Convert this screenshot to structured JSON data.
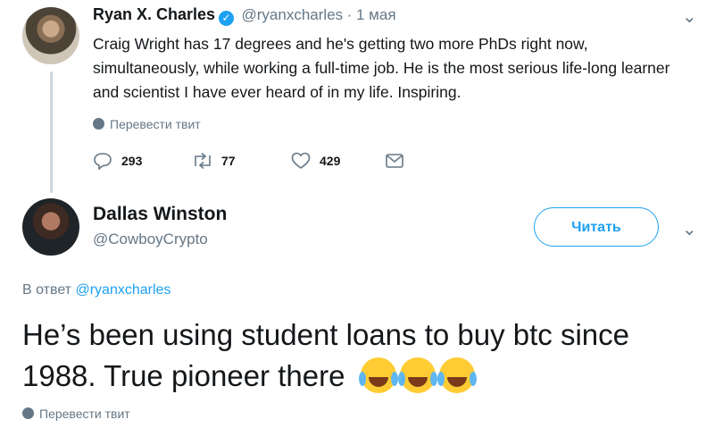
{
  "tweet1": {
    "name": "Ryan X. Charles",
    "handle": "@ryanxcharles",
    "date": "· 1 мая",
    "text": "Craig Wright has 17 degrees and he's getting two more PhDs right now, simultaneously, while working a full-time job. He is the most serious life-long learner and scientist I have ever heard of in my life. Inspiring.",
    "translate": "Перевести твит",
    "replies": "293",
    "retweets": "77",
    "likes": "429"
  },
  "tweet2": {
    "name": "Dallas Winston",
    "handle": "@CowboyCrypto",
    "follow_label": "Читать",
    "reply_prefix": "В ответ",
    "reply_handle": "@ryanxcharles",
    "text": "He’s been using student loans to buy btc since 1988.  True pioneer there",
    "emoji_name": "tears-of-joy-emoji",
    "emoji_count": 3,
    "translate": "Перевести твит"
  },
  "colors": {
    "accent": "#1da1f2",
    "muted": "#657786",
    "text": "#14171a"
  }
}
